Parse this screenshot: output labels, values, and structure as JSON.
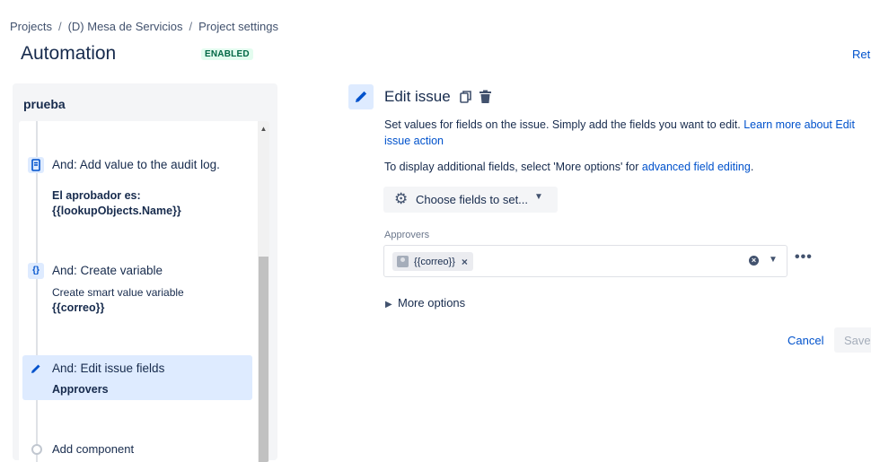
{
  "breadcrumb": [
    "Projects",
    "(D) Mesa de Servicios",
    "Project settings"
  ],
  "header": {
    "title": "Automation",
    "status": "ENABLED",
    "return_link": "Retu"
  },
  "rule": {
    "name": "prueba",
    "steps": [
      {
        "icon": "audit-log-icon",
        "title": "And: Add value to the audit log.",
        "sub": "",
        "bold": "El aprobador es: {{lookupObjects.Name}}",
        "selected": false
      },
      {
        "icon": "variable-icon",
        "title": "And: Create variable",
        "sub": "Create smart value variable",
        "bold": "{{correo}}",
        "selected": false
      },
      {
        "icon": "pencil-icon",
        "title": "And: Edit issue fields",
        "sub": "",
        "bold": "Approvers",
        "selected": true
      }
    ],
    "add_component": "Add component"
  },
  "editor": {
    "title": "Edit issue",
    "desc1_text": "Set values for fields on the issue. Simply add the fields you want to edit. ",
    "desc1_link": "Learn more about Edit issue action",
    "desc2_text": "To display additional fields, select 'More options' for ",
    "desc2_link": "advanced field editing",
    "desc2_end": ".",
    "choose_fields": "Choose fields to set...",
    "field": {
      "label": "Approvers",
      "chip": "{{correo}}"
    },
    "more_options": "More options",
    "cancel": "Cancel",
    "save": "Save"
  },
  "colors": {
    "accent": "#0052cc",
    "selected_bg": "#deebff",
    "enabled_badge": "#006644"
  }
}
